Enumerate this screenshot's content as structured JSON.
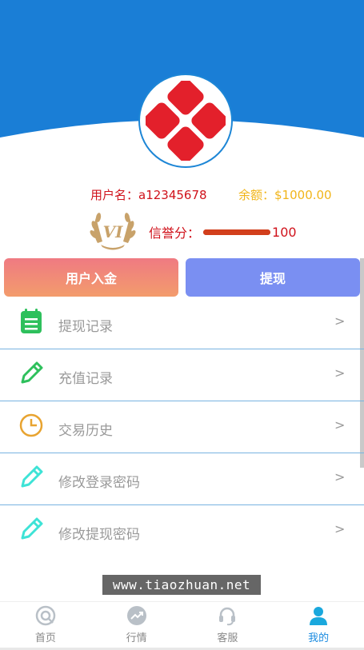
{
  "profile": {
    "username_label": "用户名：",
    "username": "a12345678",
    "balance_label": "余额：",
    "balance": "$1000.00",
    "vip_badge": "VI",
    "credit_label": "信誉分：",
    "credit_score": "100",
    "credit_fraction": 1.0
  },
  "actions": {
    "deposit_label": "用户入金",
    "withdraw_label": "提现"
  },
  "menu": {
    "items": [
      {
        "label": "提现记录",
        "icon": "notepad-icon",
        "arrow": ">"
      },
      {
        "label": "充值记录",
        "icon": "pencil-icon",
        "arrow": ">"
      },
      {
        "label": "交易历史",
        "icon": "clock-icon",
        "arrow": ">"
      },
      {
        "label": "修改登录密码",
        "icon": "pencil-icon",
        "arrow": ">"
      },
      {
        "label": "修改提现密码",
        "icon": "pencil-icon",
        "arrow": ">"
      }
    ]
  },
  "watermark": "www.tiaozhuan.net",
  "tabbar": {
    "items": [
      {
        "label": "首页",
        "icon": "home-icon",
        "active": false
      },
      {
        "label": "行情",
        "icon": "trend-icon",
        "active": false
      },
      {
        "label": "客服",
        "icon": "headset-icon",
        "active": false
      },
      {
        "label": "我的",
        "icon": "user-icon",
        "active": true
      }
    ]
  },
  "colors": {
    "header_blue": "#1a7ed6",
    "logo_red": "#e3202b",
    "accent_blue": "#1b8be0",
    "username_red": "#d0121b",
    "balance_gold": "#f1b51a"
  }
}
